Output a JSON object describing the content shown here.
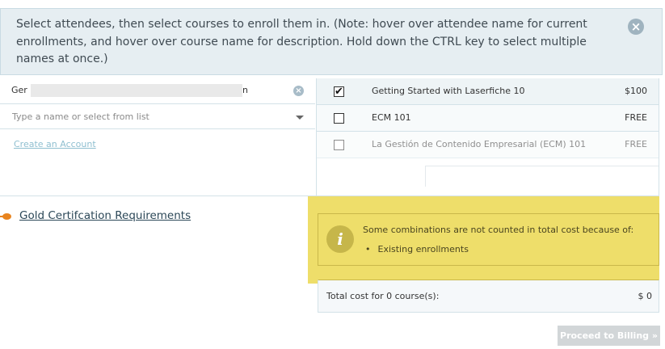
{
  "banner": {
    "text": "Select attendees, then select courses to enroll them in. (Note: hover over attendee name for current enrollments, and hover over course name for description. Hold down the CTRL key to select multiple names at once.)",
    "close_icon": "close-icon"
  },
  "attendee": {
    "name_start": "Ger",
    "name_end": "n",
    "clear_icon": "clear-icon"
  },
  "name_select": {
    "placeholder": "Type a name or select from list",
    "caret_icon": "chevron-down-icon"
  },
  "create_account_label": "Create an Account",
  "courses": [
    {
      "name": "Getting Started with Laserfiche 10",
      "price": "$100",
      "checked": true
    },
    {
      "name": "ECM 101",
      "price": "FREE",
      "checked": false
    },
    {
      "name": "La Gestión de Contenido Empresarial (ECM) 101",
      "price": "FREE",
      "checked": false
    }
  ],
  "checkmark": "✔",
  "gold_link_label": "Gold Certifcation Requirements",
  "notice": {
    "icon_glyph": "i",
    "title": "Some combinations are not counted in total cost because of:",
    "items": [
      "Existing enrollments"
    ],
    "bullet": "•",
    "highlight_color": "#eede6a"
  },
  "total": {
    "label": "Total cost for 0 course(s):",
    "value": "$ 0"
  },
  "proceed_label": "Proceed to Billing »"
}
